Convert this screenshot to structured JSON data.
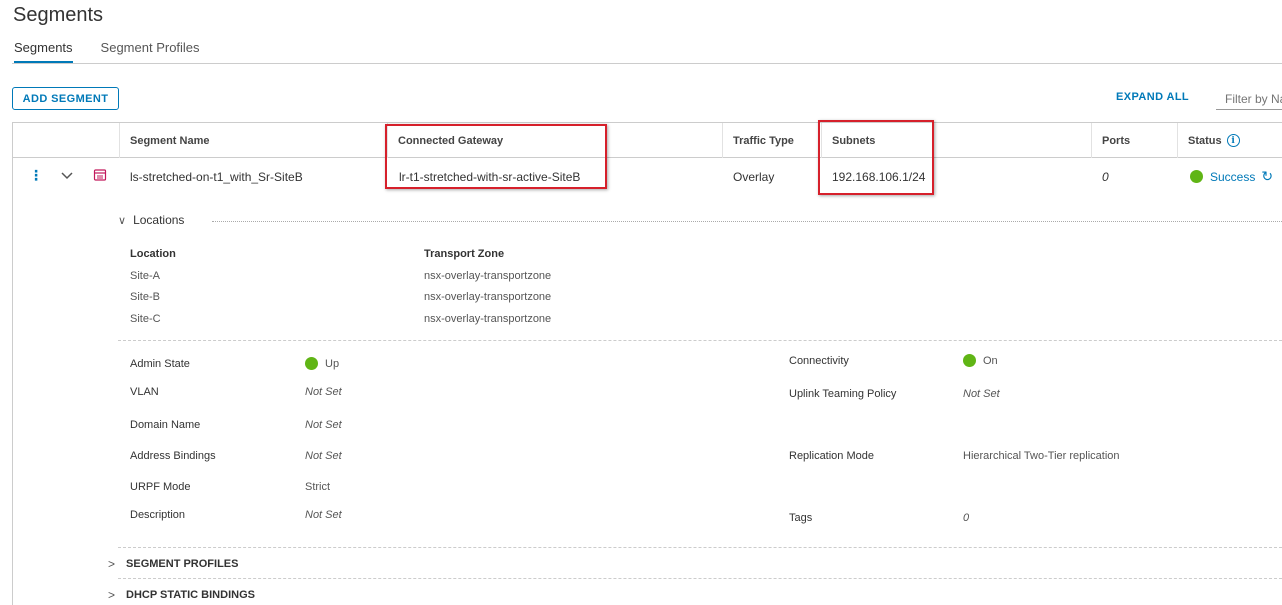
{
  "page": {
    "title": "Segments"
  },
  "tabs": [
    {
      "label": "Segments",
      "active": true
    },
    {
      "label": "Segment Profiles",
      "active": false
    }
  ],
  "toolbar": {
    "add_label": "ADD SEGMENT",
    "expand_all_label": "EXPAND ALL",
    "filter_placeholder": "Filter by Name, Path and more"
  },
  "columns": {
    "name": "Segment Name",
    "gateway": "Connected Gateway",
    "traffic": "Traffic Type",
    "subnets": "Subnets",
    "ports": "Ports",
    "status": "Status"
  },
  "segment": {
    "name": "ls-stretched-on-t1_with_Sr-SiteB",
    "gateway": "lr-t1-stretched-with-sr-active-SiteB",
    "traffic": "Overlay",
    "subnets": "192.168.106.1/24",
    "ports": "0",
    "status": "Success"
  },
  "locations": {
    "title": "Locations",
    "headers": {
      "location": "Location",
      "zone": "Transport Zone"
    },
    "rows": [
      {
        "location": "Site-A",
        "zone": "nsx-overlay-transportzone"
      },
      {
        "location": "Site-B",
        "zone": "nsx-overlay-transportzone"
      },
      {
        "location": "Site-C",
        "zone": "nsx-overlay-transportzone"
      }
    ]
  },
  "details": {
    "admin_state": {
      "label": "Admin State",
      "value": "Up"
    },
    "vlan": {
      "label": "VLAN",
      "value": "Not Set"
    },
    "domain_name": {
      "label": "Domain Name",
      "value": "Not Set"
    },
    "address_bindings": {
      "label": "Address Bindings",
      "value": "Not Set"
    },
    "urpf_mode": {
      "label": "URPF Mode",
      "value": "Strict"
    },
    "description": {
      "label": "Description",
      "value": "Not Set"
    },
    "connectivity": {
      "label": "Connectivity",
      "value": "On"
    },
    "uplink_teaming": {
      "label": "Uplink Teaming Policy",
      "value": "Not Set"
    },
    "replication_mode": {
      "label": "Replication Mode",
      "value": "Hierarchical Two-Tier replication"
    },
    "tags": {
      "label": "Tags",
      "value": "0"
    }
  },
  "sections": {
    "segment_profiles": "SEGMENT PROFILES",
    "dhcp_bindings": "DHCP STATIC BINDINGS"
  },
  "colors": {
    "accent": "#0079b8",
    "success": "#60b515",
    "highlight": "#d6202b"
  }
}
